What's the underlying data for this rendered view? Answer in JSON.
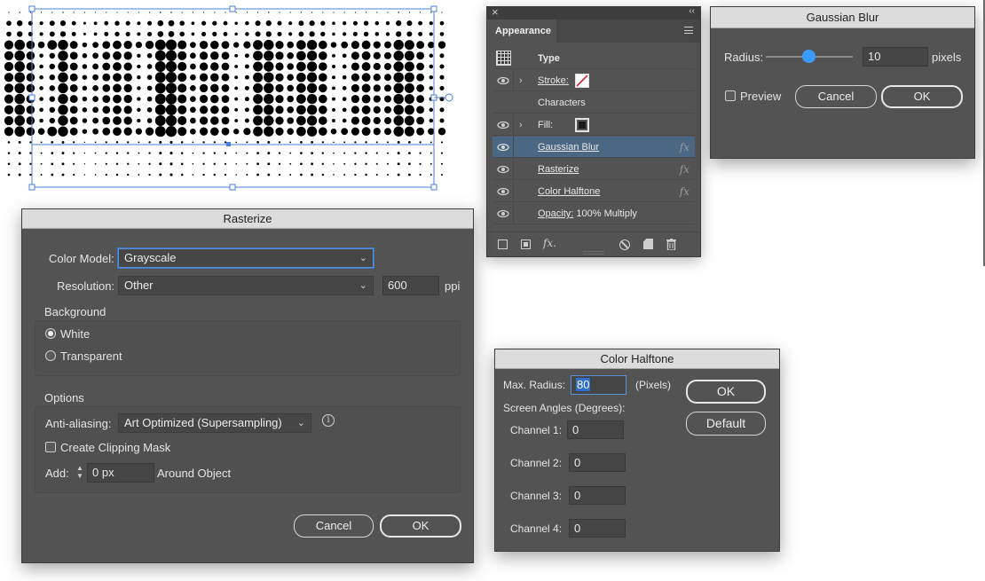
{
  "appearance": {
    "tab_label": "Appearance",
    "rows": [
      {
        "label": "Type"
      },
      {
        "label": "Stroke:"
      },
      {
        "label": "Characters"
      },
      {
        "label": "Fill:"
      },
      {
        "label": "Gaussian Blur",
        "fx": "fx"
      },
      {
        "label": "Rasterize",
        "fx": "fx"
      },
      {
        "label": "Color Halftone",
        "fx": "fx"
      },
      {
        "label": "Opacity:",
        "value": "100% Multiply"
      }
    ],
    "bottom_fx_label": "fx.",
    "close_glyph": "×",
    "collapse_glyph": "‹‹",
    "colors": {
      "selected_row": "#4a6784",
      "panel": "#535353"
    }
  },
  "gaussian_blur": {
    "title": "Gaussian Blur",
    "radius_label": "Radius:",
    "radius_value": "10",
    "radius_unit": "pixels",
    "slider_fraction": 0.49,
    "preview_label": "Preview",
    "cancel_label": "Cancel",
    "ok_label": "OK",
    "accent": "#3b9cff"
  },
  "rasterize": {
    "title": "Rasterize",
    "color_model_label": "Color Model:",
    "color_model_value": "Grayscale",
    "resolution_label": "Resolution:",
    "resolution_value": "Other",
    "ppi_value": "600",
    "ppi_unit": "ppi",
    "background_heading": "Background",
    "white_label": "White",
    "transparent_label": "Transparent",
    "options_heading": "Options",
    "anti_aliasing_label": "Anti-aliasing:",
    "anti_aliasing_value": "Art Optimized (Supersampling)",
    "clipping_mask_label": "Create Clipping Mask",
    "add_label": "Add:",
    "add_value": "0 px",
    "around_object_label": "Around Object",
    "cancel_label": "Cancel",
    "ok_label": "OK"
  },
  "color_halftone": {
    "title": "Color Halftone",
    "max_radius_label": "Max. Radius:",
    "max_radius_value": "80",
    "max_radius_unit": "(Pixels)",
    "screen_angles_label": "Screen Angles (Degrees):",
    "channels": [
      {
        "label": "Channel 1:",
        "value": "0"
      },
      {
        "label": "Channel 2:",
        "value": "0"
      },
      {
        "label": "Channel 3:",
        "value": "0"
      },
      {
        "label": "Channel 4:",
        "value": "0"
      }
    ],
    "ok_label": "OK",
    "default_label": "Default"
  }
}
